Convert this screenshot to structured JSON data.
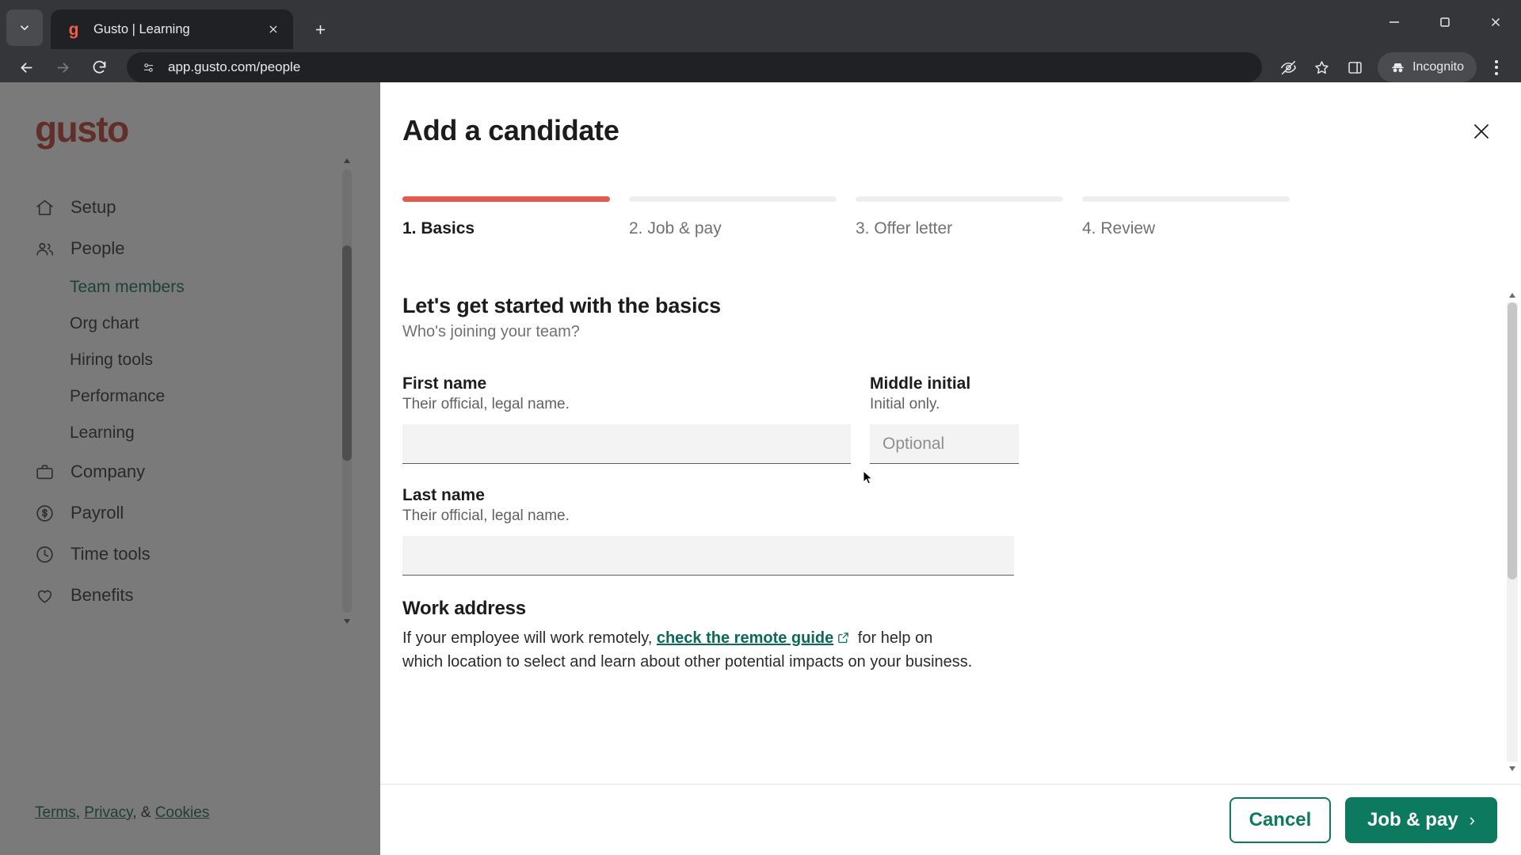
{
  "browser": {
    "tab": {
      "title": "Gusto | Learning",
      "favicon_letter": "g"
    },
    "new_tab_label": "+",
    "url": "app.gusto.com/people",
    "profile_label": "Incognito",
    "icons": {
      "tab_search": "chevron-down-icon",
      "back": "back-arrow-icon",
      "forward": "forward-arrow-icon",
      "reload": "reload-icon",
      "site_info": "site-settings-icon",
      "tracking": "eye-off-icon",
      "bookmark": "star-icon",
      "side_panel": "side-panel-icon",
      "incognito": "incognito-hat-icon",
      "menu": "three-dot-menu-icon",
      "minimize": "minimize-icon",
      "maximize": "maximize-icon",
      "close_window": "close-window-icon"
    }
  },
  "sidebar": {
    "logo": "gusto",
    "items": [
      {
        "label": "Setup",
        "icon": "home-icon"
      },
      {
        "label": "People",
        "icon": "people-icon"
      }
    ],
    "sub_items": [
      {
        "label": "Team members",
        "active": true
      },
      {
        "label": "Org chart",
        "active": false
      },
      {
        "label": "Hiring tools",
        "active": false
      },
      {
        "label": "Performance",
        "active": false
      },
      {
        "label": "Learning",
        "active": false
      }
    ],
    "items_lower": [
      {
        "label": "Company",
        "icon": "briefcase-icon"
      },
      {
        "label": "Payroll",
        "icon": "dollar-circle-icon"
      },
      {
        "label": "Time tools",
        "icon": "clock-icon"
      },
      {
        "label": "Benefits",
        "icon": "heart-icon"
      }
    ],
    "footer": {
      "terms": "Terms",
      "comma": ", ",
      "privacy": "Privacy",
      "amp": ", & ",
      "cookies": "Cookies"
    }
  },
  "modal": {
    "title": "Add a candidate",
    "close_icon": "close-icon",
    "steps": [
      {
        "label": "1. Basics",
        "active": true
      },
      {
        "label": "2. Job & pay",
        "active": false
      },
      {
        "label": "3. Offer letter",
        "active": false
      },
      {
        "label": "4. Review",
        "active": false
      }
    ],
    "section": {
      "title": "Let's get started with the basics",
      "subtitle": "Who's joining your team?"
    },
    "fields": {
      "first_name": {
        "label": "First name",
        "hint": "Their official, legal name.",
        "value": "",
        "placeholder": ""
      },
      "middle_initial": {
        "label": "Middle initial",
        "hint": "Initial only.",
        "value": "",
        "placeholder": "Optional"
      },
      "last_name": {
        "label": "Last name",
        "hint": "Their official, legal name.",
        "value": "",
        "placeholder": ""
      }
    },
    "work_address": {
      "title": "Work address",
      "text_before": "If your employee will work remotely, ",
      "link": "check the remote guide",
      "link_icon": "external-link-icon",
      "text_after": " for help on which location to select and learn about other potential impacts on your business."
    },
    "footer": {
      "cancel_label": "Cancel",
      "next_label": "Job & pay",
      "next_chevron": "›"
    }
  },
  "colors": {
    "accent_red": "#e45a51",
    "accent_teal": "#0d7a5f",
    "gusto_red": "#c0392b",
    "link_green": "#0a6b54"
  }
}
